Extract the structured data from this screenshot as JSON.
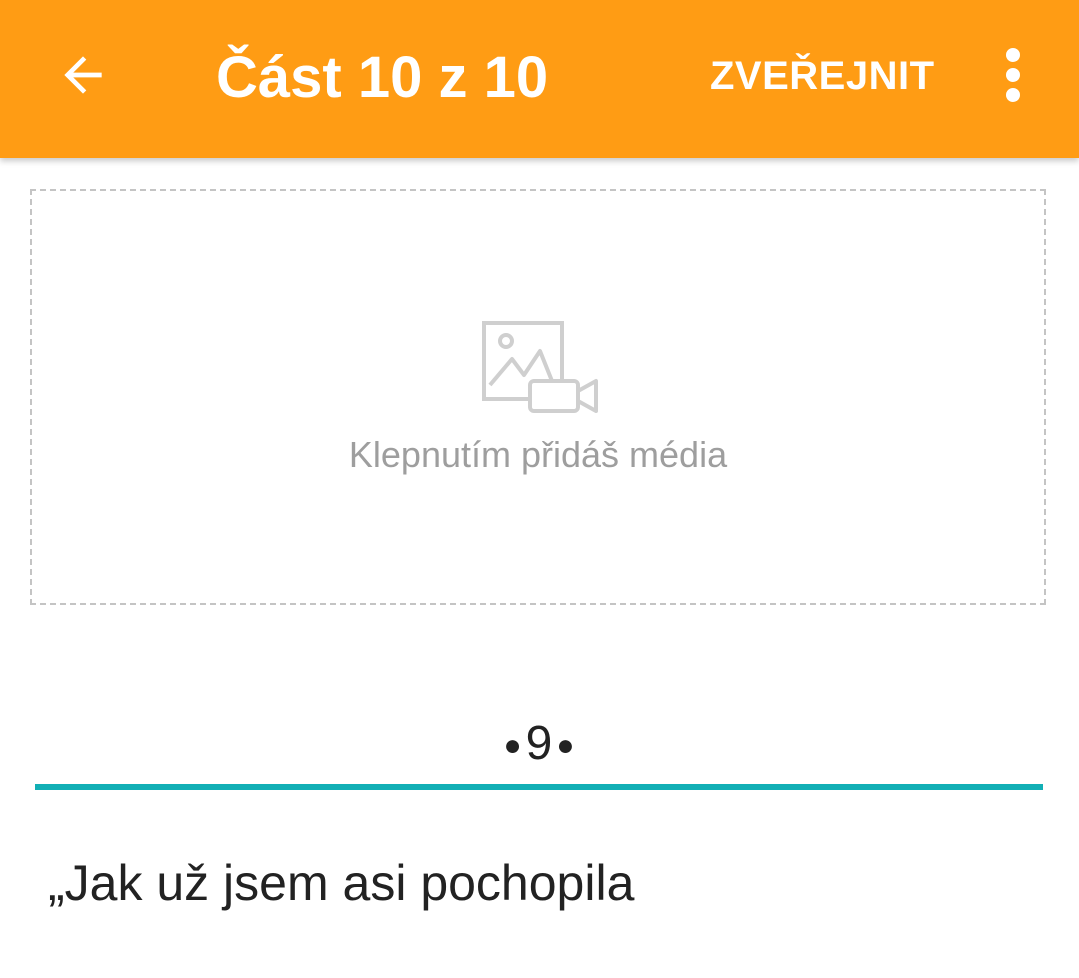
{
  "appbar": {
    "background_color": "#FF9C14",
    "back_icon": "arrow-left-icon",
    "title": "Část 10 z 10",
    "publish_label": "ZVEŘEJNIT",
    "overflow_icon": "more-vertical-icon"
  },
  "media": {
    "icon": "image-video-icon",
    "placeholder": "Klepnutím přidáš média"
  },
  "chapter": {
    "number": "9",
    "divider_color": "#12AFB5"
  },
  "editor": {
    "text": "„Jak už jsem asi pochopila"
  }
}
